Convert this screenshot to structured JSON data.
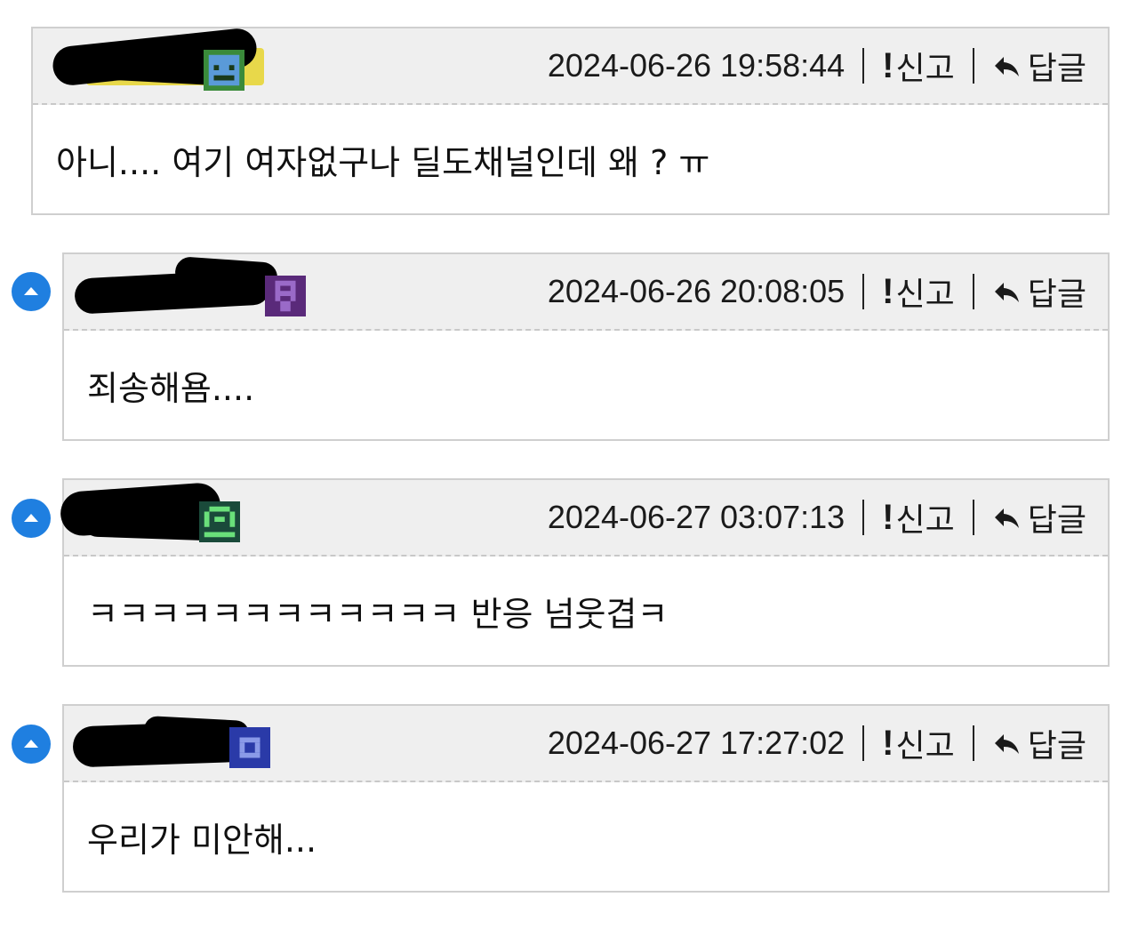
{
  "comments": [
    {
      "timestamp": "2024-06-26 19:58:44",
      "report_label": "신고",
      "reply_label": "답글",
      "text": "아니.... 여기 여자없구나 딜도채널인데 왜 ? ㅠ",
      "is_reply": false,
      "avatar_color": "#3a7a3a"
    },
    {
      "timestamp": "2024-06-26 20:08:05",
      "report_label": "신고",
      "reply_label": "답글",
      "text": "죄송해욤....",
      "is_reply": true,
      "avatar_color": "#5a2a7a"
    },
    {
      "timestamp": "2024-06-27 03:07:13",
      "report_label": "신고",
      "reply_label": "답글",
      "text": "ㅋㅋㅋㅋㅋㅋㅋㅋㅋㅋㅋㅋ 반응 넘웃겹ㅋ",
      "is_reply": true,
      "avatar_color": "#2a6a4a"
    },
    {
      "timestamp": "2024-06-27 17:27:02",
      "report_label": "신고",
      "reply_label": "답글",
      "text": "우리가 미안해...",
      "is_reply": true,
      "avatar_color": "#2a3a9a"
    }
  ],
  "icons": {
    "report": "exclamation-icon",
    "reply": "reply-arrow-icon",
    "up": "arrow-up-circle-icon"
  },
  "colors": {
    "accent": "#1f7fe0",
    "header_bg": "#efefef",
    "border": "#cfcfcf"
  }
}
